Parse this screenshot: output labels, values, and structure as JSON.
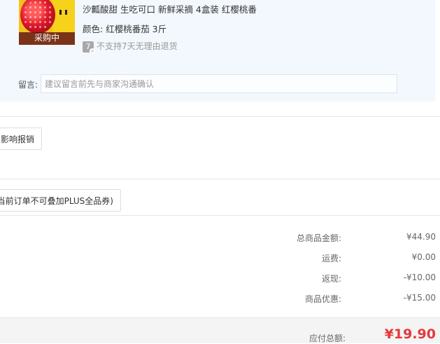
{
  "product": {
    "title": "沙瓤酸甜 生吃可口 新鲜采摘 4盒装 红樱桃番",
    "image_overlay": "采购中",
    "color_label": "颜色:",
    "color_value": "红樱桃番茄 3斤",
    "return_badge": "7",
    "return_policy": "不支持7天无理由退货"
  },
  "remark": {
    "label": "留言:",
    "placeholder": "建议留言前先与商家沟通确认"
  },
  "invoice_button": "影响报销",
  "coupon_button": "当前订单不可叠加PLUS全品券)",
  "summary": [
    {
      "label": "总商品金额:",
      "value": "¥44.90"
    },
    {
      "label": "运费:",
      "value": "¥0.00"
    },
    {
      "label": "返现:",
      "value": "-¥10.00"
    },
    {
      "label": "商品优惠:",
      "value": "-¥15.00"
    }
  ],
  "total": {
    "label": "应付总额:",
    "value": "¥19.90"
  },
  "colors": {
    "price_red": "#e4393c",
    "panel_bg": "#f3f8fe"
  }
}
